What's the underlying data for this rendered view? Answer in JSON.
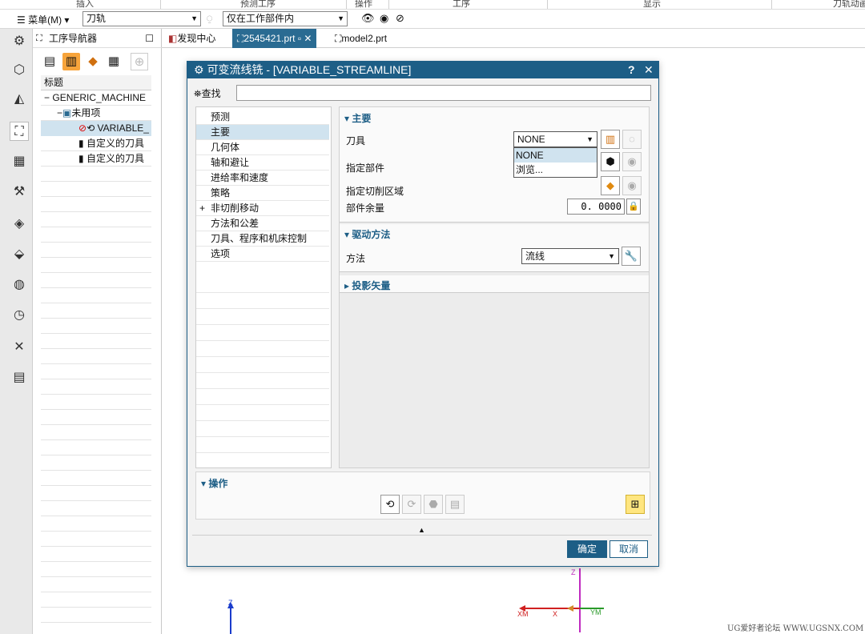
{
  "ribbon": {
    "insert": "插入",
    "predict": "预测工序",
    "operation": "操作",
    "process": "工序",
    "display": "显示",
    "toolpath_anim": "刀轨动画"
  },
  "toolbar": {
    "menu_label": "菜单(M)",
    "filter_value": "刀轨",
    "scope_value": "仅在工作部件内"
  },
  "navigator": {
    "title": "工序导航器",
    "column_header": "标题",
    "tree": [
      {
        "label": "GENERIC_MACHINE",
        "prefix": "−"
      },
      {
        "label": "未用项",
        "prefix": "−"
      },
      {
        "label": "VARIABLE_",
        "prefix": ""
      },
      {
        "label": "自定义的刀具",
        "prefix": ""
      },
      {
        "label": "自定义的刀具",
        "prefix": ""
      }
    ]
  },
  "tabs": [
    {
      "label": "发现中心"
    },
    {
      "label": "2545421.prt"
    },
    {
      "label": "model2.prt"
    }
  ],
  "dialog": {
    "title": "可变流线铣 - [VARIABLE_STREAMLINE]",
    "help": "?",
    "close": "✕",
    "find_label": "查找",
    "find_value": "",
    "nav_items": [
      {
        "label": "预测"
      },
      {
        "label": "主要"
      },
      {
        "label": "几何体"
      },
      {
        "label": "轴和避让"
      },
      {
        "label": "进给率和速度"
      },
      {
        "label": "策略"
      },
      {
        "label": "非切削移动",
        "expander": "+"
      },
      {
        "label": "方法和公差"
      },
      {
        "label": "刀具、程序和机床控制"
      },
      {
        "label": "选项"
      }
    ],
    "main_section": "主要",
    "tool_label": "刀具",
    "tool_value": "NONE",
    "tool_options": [
      "NONE",
      "浏览..."
    ],
    "part_label": "指定部件",
    "cut_area_label": "指定切削区域",
    "stock_label": "部件余量",
    "stock_value": "0. 0000",
    "drive_section": "驱动方法",
    "method_label": "方法",
    "method_value": "流线",
    "projection_section": "投影矢量",
    "actions_section": "操作",
    "ok_label": "确定",
    "cancel_label": "取消"
  },
  "viewport": {
    "axis_z": "Z",
    "axis_xm": "XM",
    "axis_x": "X",
    "axis_ym": "YM",
    "watermark": "UG爱好者论坛 WWW.UGSNX.COM"
  },
  "colors": {
    "accent": "#1d5e86",
    "selected_row": "#d0e3ef",
    "highlight_button": "#ffe680"
  }
}
